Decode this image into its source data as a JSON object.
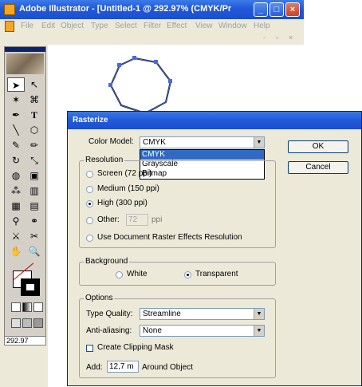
{
  "app": {
    "title": "Adobe Illustrator - [Untitled-1 @ 292.97% (CMYK/Pr",
    "menus": [
      "File",
      "Edit",
      "Object",
      "Type",
      "Select",
      "Filter",
      "Effect",
      "View",
      "Window",
      "Help"
    ],
    "zoom": "292.97",
    "subbar_icons": [
      "-",
      "▫",
      "×"
    ]
  },
  "dialog": {
    "title": "Rasterize",
    "color_model": {
      "label": "Color Model:",
      "value": "CMYK",
      "options": [
        "CMYK",
        "Grayscale",
        "Bitmap"
      ],
      "highlighted": "CMYK"
    },
    "ok": "OK",
    "cancel": "Cancel",
    "resolution": {
      "label": "Resolution",
      "options": [
        "Screen (72 ppi)",
        "Medium (150 ppi)",
        "High (300 ppi)",
        "Other:",
        "Use Document Raster Effects Resolution"
      ],
      "selected": "High (300 ppi)",
      "other_value": "72",
      "other_unit": "ppi"
    },
    "background": {
      "label": "Background",
      "white": "White",
      "transparent": "Transparent",
      "selected": "Transparent"
    },
    "options": {
      "label": "Options",
      "type_quality_label": "Type Quality:",
      "type_quality_value": "Streamline",
      "antialiasing_label": "Anti-aliasing:",
      "antialiasing_value": "None",
      "clipping_mask_label": "Create Clipping Mask",
      "clipping_mask_checked": false,
      "add_label": "Add:",
      "add_value": "12,7 m",
      "around_label": "Around Object"
    }
  },
  "colors": {
    "title_bar": "#2158d9",
    "dialog_bg": "#ece9d8",
    "highlight": "#316ac5"
  }
}
